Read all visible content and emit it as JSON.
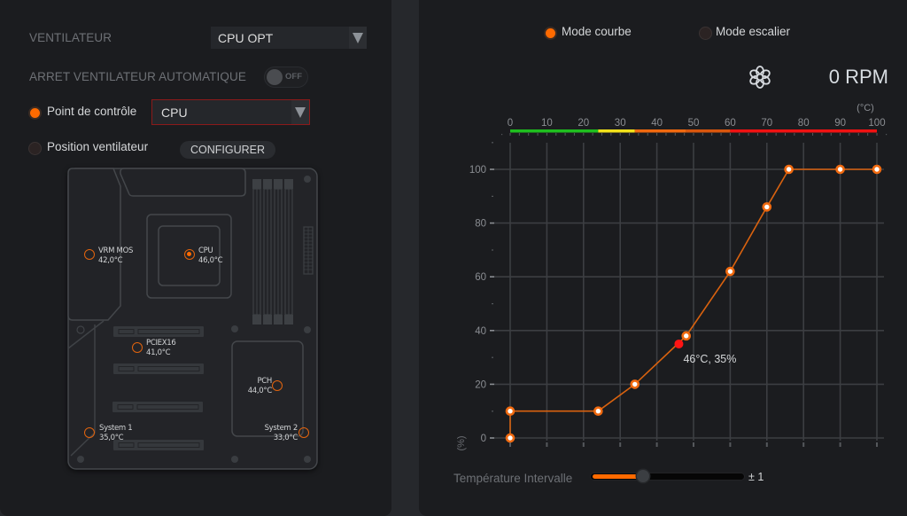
{
  "left_panel": {
    "fan_label": "VENTILATEUR",
    "fan_select": {
      "value": "CPU OPT"
    },
    "auto_stop": {
      "label": "ARRET VENTILATEUR AUTOMATIQUE",
      "state": "OFF"
    },
    "control_point": {
      "label": "Point de contrôle",
      "selected": true,
      "select_value": "CPU"
    },
    "fan_position": {
      "label": "Position ventilateur",
      "selected": false,
      "configure_label": "CONFIGURER"
    },
    "sensors": [
      {
        "name": "VRM MOS",
        "temp": "42,0°C",
        "active": false
      },
      {
        "name": "CPU",
        "temp": "46,0°C",
        "active": true
      },
      {
        "name": "PCIEX16",
        "temp": "41,0°C",
        "active": false
      },
      {
        "name": "PCH",
        "temp": "44,0°C",
        "active": false
      },
      {
        "name": "System 1",
        "temp": "35,0°C",
        "active": false
      },
      {
        "name": "System 2",
        "temp": "33,0°C",
        "active": false
      }
    ]
  },
  "right_panel": {
    "modes": [
      {
        "label": "Mode courbe",
        "selected": true
      },
      {
        "label": "Mode escalier",
        "selected": false
      }
    ],
    "fan_icon": "fan-icon",
    "fan_speed": "0 RPM",
    "temp_interval": {
      "label": "Température Intervalle",
      "value_label": "± 1",
      "slider_fraction": 0.34
    }
  },
  "colors": {
    "accent": "#ff6a00",
    "curve_line": "#d9620f",
    "curve_point_ring": "#f06a10",
    "current_point": "#ff1414",
    "select_error_border": "#8b1a1a"
  },
  "chart_data": {
    "type": "line",
    "title": "",
    "xlabel": "(°C)",
    "ylabel": "(%)",
    "xlim": [
      0,
      100
    ],
    "ylim": [
      0,
      100
    ],
    "grid": true,
    "x_ticks": [
      "0",
      "10",
      "20",
      "30",
      "40",
      "50",
      "60",
      "70",
      "80",
      "90",
      "100"
    ],
    "y_ticks": [
      "0",
      "20",
      "40",
      "60",
      "80",
      "100"
    ],
    "series": [
      {
        "name": "fan-curve",
        "x": [
          0,
          0,
          24,
          34,
          48,
          60,
          70,
          76,
          90,
          100
        ],
        "y": [
          0,
          10,
          10,
          20,
          38,
          62,
          86,
          100,
          100,
          100
        ]
      }
    ],
    "current_point": {
      "x": 46,
      "y": 35,
      "label": "46°C, 35%"
    },
    "temperature_bands": [
      {
        "from": 0,
        "to": 24,
        "color": "#1fbf1f"
      },
      {
        "from": 24,
        "to": 34,
        "color": "#f2e11a"
      },
      {
        "from": 34,
        "to": 48,
        "color": "#f0690f"
      },
      {
        "from": 48,
        "to": 60,
        "color": "#d9560d"
      },
      {
        "from": 60,
        "to": 100,
        "color": "#f01212"
      }
    ]
  }
}
